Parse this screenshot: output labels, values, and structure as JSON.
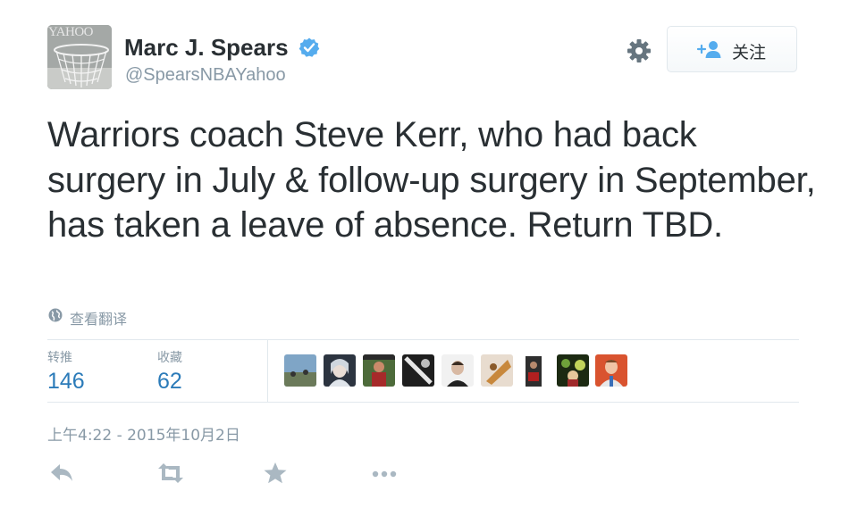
{
  "author": {
    "name": "Marc J. Spears",
    "handle": "@SpearsNBAYahoo",
    "avatar_text": "YAHOO",
    "verified_icon": "verified-badge-icon"
  },
  "header": {
    "settings_icon": "gear-icon",
    "follow_icon": "add-user-icon",
    "follow_label": "关注"
  },
  "tweet": {
    "text": "Warriors coach Steve Kerr, who had back surgery in July & follow-up surgery in September, has taken a leave of absence. Return TBD.",
    "translate_label": "查看翻译"
  },
  "stats": {
    "retweets_label": "转推",
    "retweets_value": "146",
    "likes_label": "收藏",
    "likes_value": "62"
  },
  "likers": [
    {
      "name": "liker-avatar-1"
    },
    {
      "name": "liker-avatar-2"
    },
    {
      "name": "liker-avatar-3"
    },
    {
      "name": "liker-avatar-4"
    },
    {
      "name": "liker-avatar-5"
    },
    {
      "name": "liker-avatar-6"
    },
    {
      "name": "liker-avatar-7"
    },
    {
      "name": "liker-avatar-8"
    },
    {
      "name": "liker-avatar-9"
    }
  ],
  "timestamp": "上午4:22 - 2015年10月2日",
  "actions": [
    "reply-icon",
    "retweet-icon",
    "favorite-icon",
    "more-icon"
  ],
  "colors": {
    "link_blue": "#2b7bb9",
    "muted_gray": "#8899a6",
    "text_dark": "#292f33",
    "verified_blue": "#55acee",
    "action_gray": "#aab8c2"
  }
}
